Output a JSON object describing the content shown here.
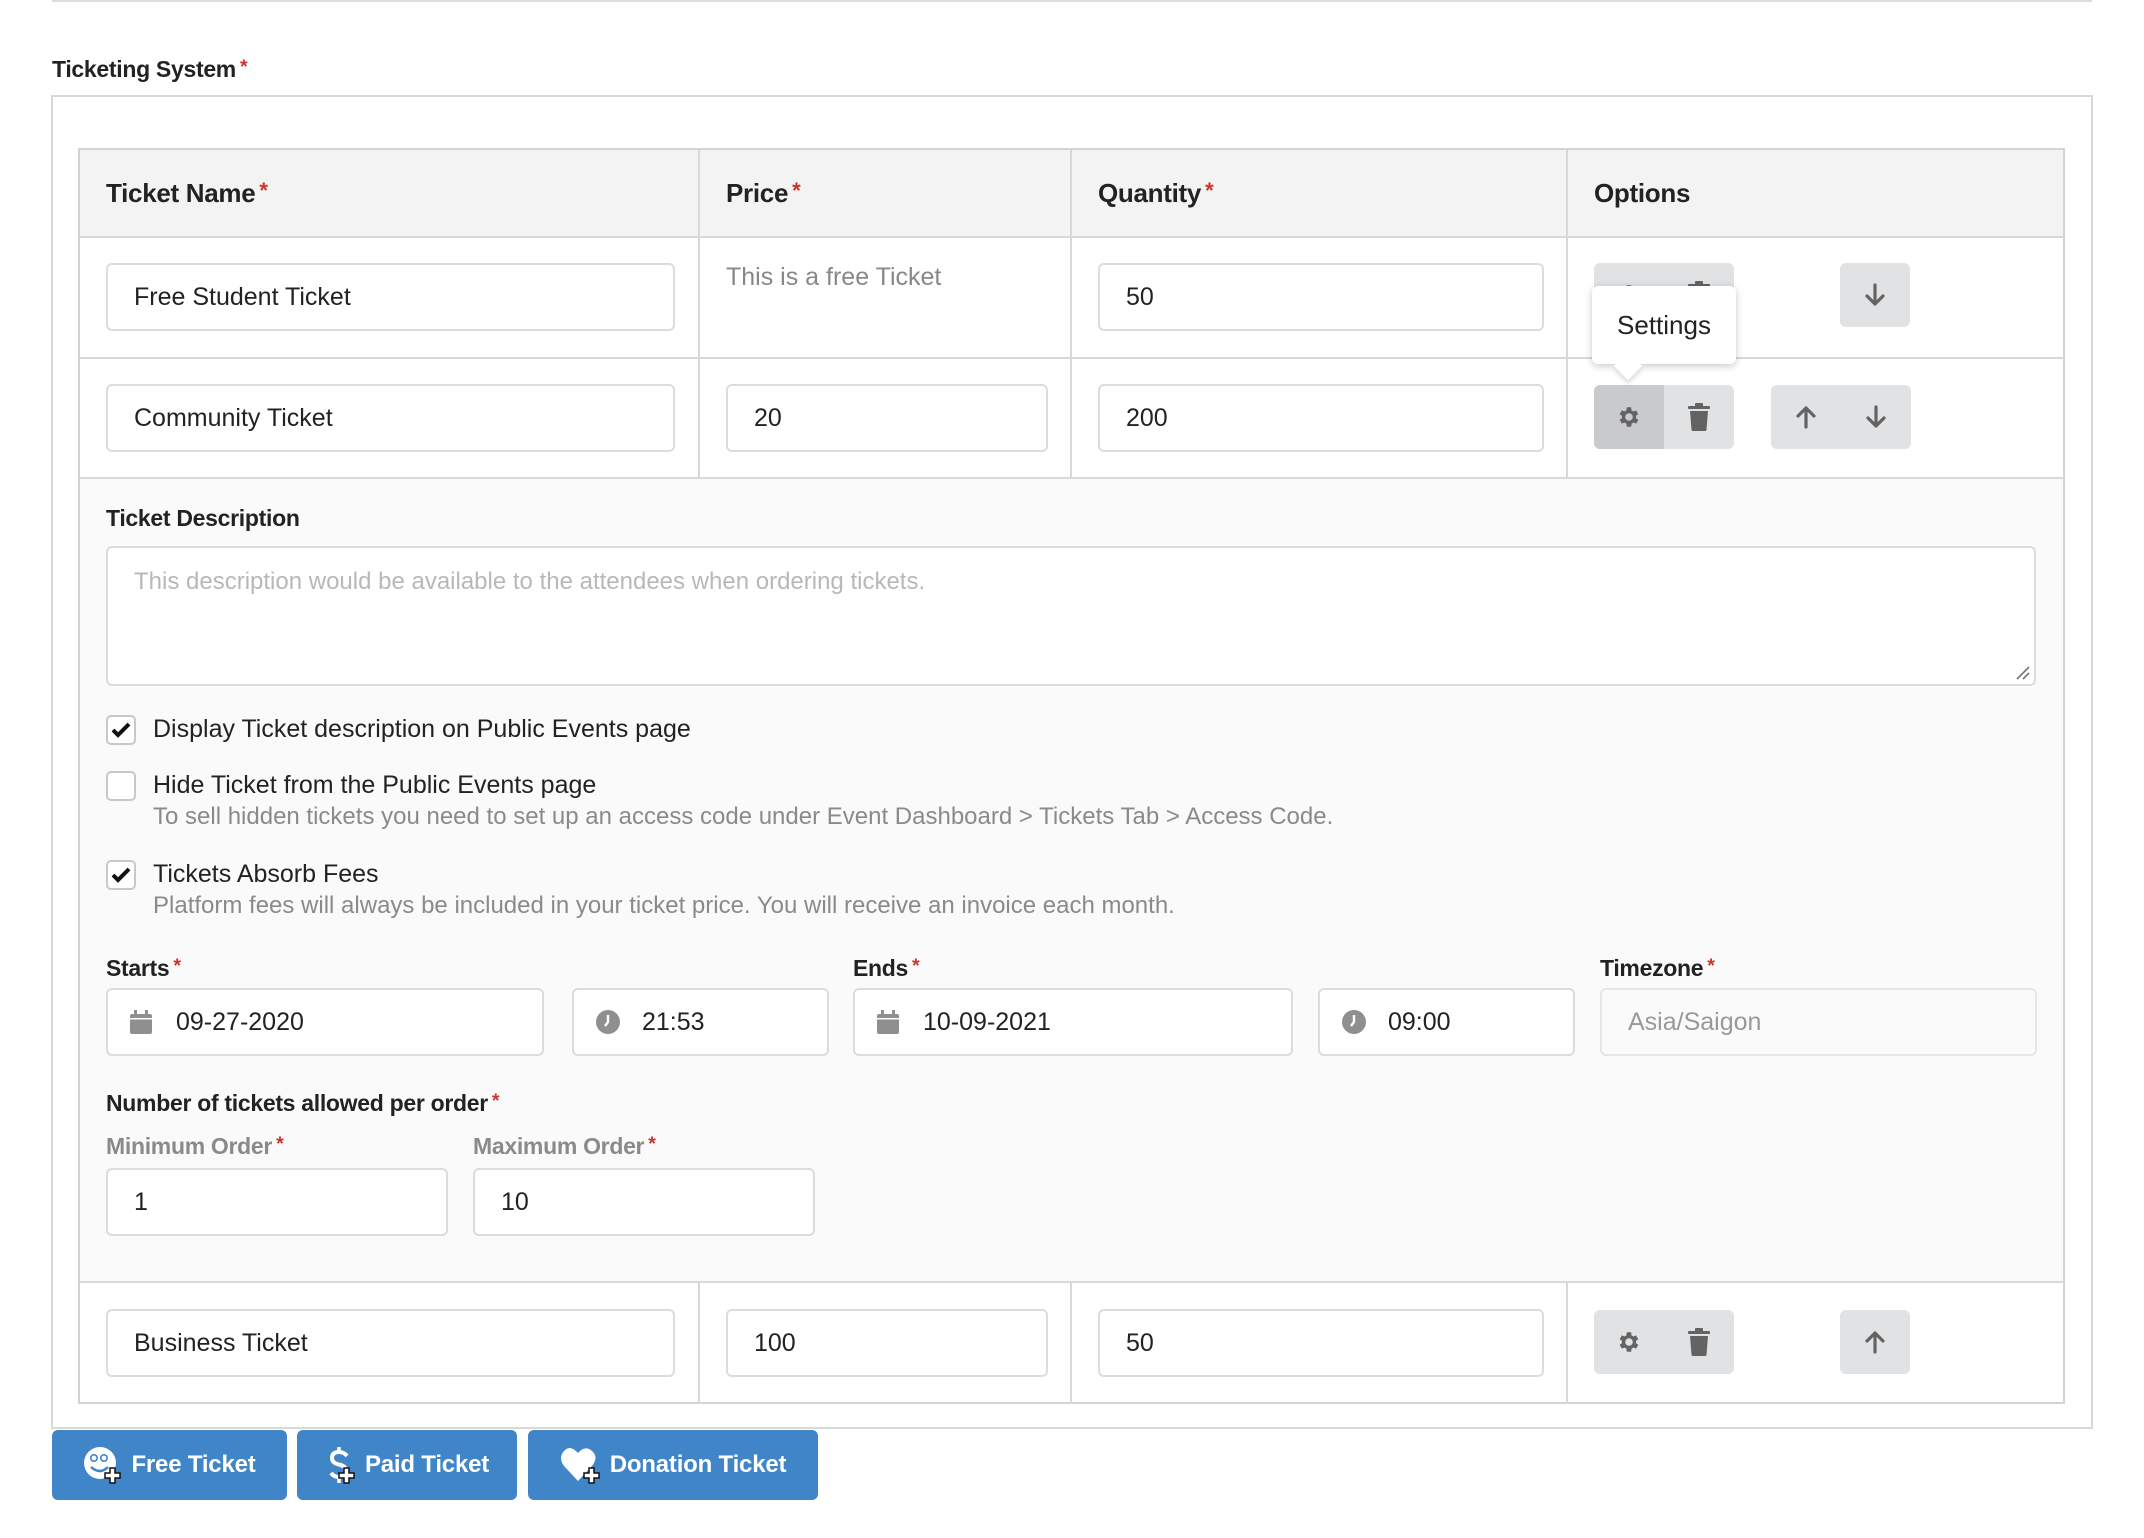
{
  "section": {
    "title": "Ticketing System",
    "required_mark": "*"
  },
  "table": {
    "headers": [
      {
        "label": "Ticket Name",
        "required": "*"
      },
      {
        "label": "Price",
        "required": "*"
      },
      {
        "label": "Quantity",
        "required": "*"
      },
      {
        "label": "Options",
        "required": ""
      }
    ],
    "rows": [
      {
        "name": "Free Student Ticket",
        "price_text": "This is a free Ticket",
        "quantity": "50",
        "actions": [
          "settings",
          "delete",
          "move-down"
        ]
      },
      {
        "name": "Community Ticket",
        "price": "20",
        "quantity": "200",
        "actions": [
          "settings",
          "delete",
          "move-up",
          "move-down"
        ]
      },
      {
        "name": "Business Ticket",
        "price": "100",
        "quantity": "50",
        "actions": [
          "settings",
          "delete",
          "move-up"
        ]
      }
    ]
  },
  "tooltip": {
    "text": "Settings"
  },
  "settings_panel": {
    "description_label": "Ticket Description",
    "description_placeholder": "This description would be available to the attendees when ordering tickets.",
    "checkboxes": [
      {
        "label": "Display Ticket description on Public Events page",
        "checked": true,
        "help": ""
      },
      {
        "label": "Hide Ticket from the Public Events page",
        "checked": false,
        "help": "To sell hidden tickets you need to set up an access code under Event Dashboard > Tickets Tab > Access Code."
      },
      {
        "label": "Tickets Absorb Fees",
        "checked": true,
        "help": "Platform fees will always be included in your ticket price. You will receive an invoice each month."
      }
    ],
    "starts": {
      "label": "Starts",
      "required": "*",
      "date": "09-27-2020",
      "time": "21:53"
    },
    "ends": {
      "label": "Ends",
      "required": "*",
      "date": "10-09-2021",
      "time": "09:00"
    },
    "timezone": {
      "label": "Timezone",
      "required": "*",
      "value": "Asia/Saigon"
    },
    "order_limits": {
      "label": "Number of tickets allowed per order",
      "required": "*",
      "min_label": "Minimum Order",
      "min_value": "1",
      "max_label": "Maximum Order",
      "max_value": "10"
    }
  },
  "add_buttons": [
    {
      "label": "Free Ticket",
      "icon": "smiley-plus-icon"
    },
    {
      "label": "Paid Ticket",
      "icon": "dollar-plus-icon"
    },
    {
      "label": "Donation Ticket",
      "icon": "heart-plus-icon"
    }
  ],
  "colors": {
    "primary": "#4085c8",
    "required": "#d0312d",
    "header_bg": "#f3f3f3",
    "panel_bg": "#fafafa",
    "icon_button_bg": "#e1e2e4"
  }
}
